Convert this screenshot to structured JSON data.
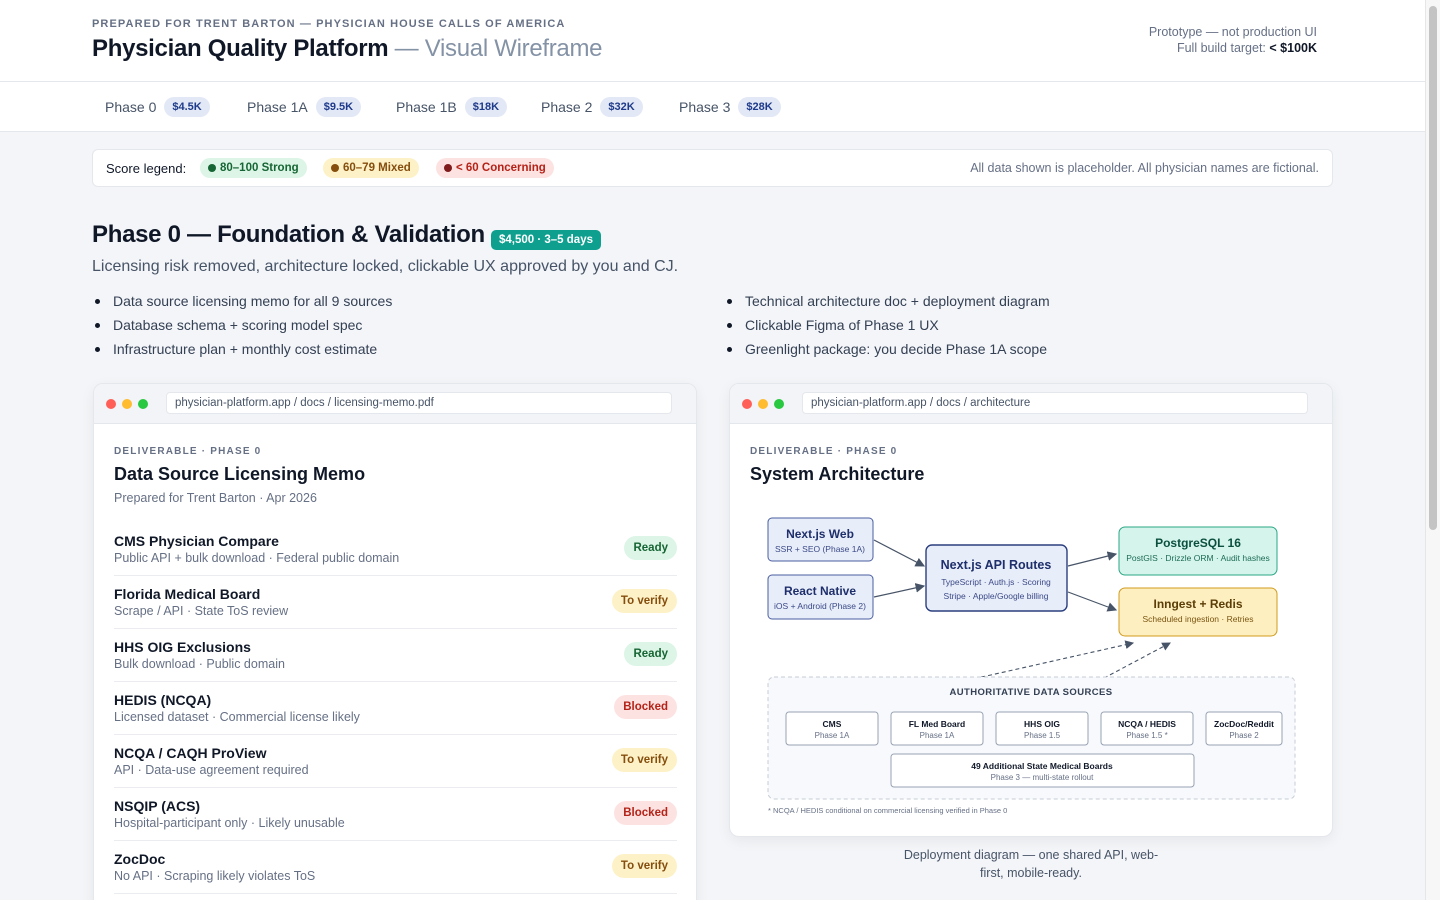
{
  "header": {
    "kicker": "PREPARED FOR TRENT BARTON — PHYSICIAN HOUSE CALLS OF AMERICA",
    "title": "Physician Quality Platform",
    "subtitle": "— Visual Wireframe",
    "proto_line1": "Prototype — not production UI",
    "proto_line2_prefix": "Full build target: ",
    "proto_line2_value": "< $100K"
  },
  "tabs": [
    {
      "label": "Phase 0",
      "price": "$4.5K"
    },
    {
      "label": "Phase 1A",
      "price": "$9.5K"
    },
    {
      "label": "Phase 1B",
      "price": "$18K"
    },
    {
      "label": "Phase 2",
      "price": "$32K"
    },
    {
      "label": "Phase 3",
      "price": "$28K"
    }
  ],
  "legend": {
    "label": "Score legend:",
    "strong": "80–100 Strong",
    "mixed": "60–79 Mixed",
    "concerning": "< 60 Concerning",
    "note": "All data shown is placeholder. All physician names are fictional."
  },
  "phase": {
    "title": "Phase 0 — Foundation & Validation",
    "badge": "$4,500 · 3–5 days",
    "desc": "Licensing risk removed, architecture locked, clickable UX approved by you and CJ.",
    "bullets_left": [
      "Data source licensing memo for all 9 sources",
      "Database schema + scoring model spec",
      "Infrastructure plan + monthly cost estimate"
    ],
    "bullets_right": [
      "Technical architecture doc + deployment diagram",
      "Clickable Figma of Phase 1 UX",
      "Greenlight package: you decide Phase 1A scope"
    ]
  },
  "memo": {
    "url": "physician-platform.app / docs / licensing-memo.pdf",
    "kicker": "DELIVERABLE · PHASE 0",
    "title": "Data Source Licensing Memo",
    "prepared": "Prepared for Trent Barton · Apr 2026",
    "sources": [
      {
        "name": "CMS Physician Compare",
        "desc": "Public API + bulk download · Federal public domain",
        "status": "Ready",
        "kind": "ready"
      },
      {
        "name": "Florida Medical Board",
        "desc": "Scrape / API · State ToS review",
        "status": "To verify",
        "kind": "verify"
      },
      {
        "name": "HHS OIG Exclusions",
        "desc": "Bulk download · Public domain",
        "status": "Ready",
        "kind": "ready"
      },
      {
        "name": "HEDIS (NCQA)",
        "desc": "Licensed dataset · Commercial license likely",
        "status": "Blocked",
        "kind": "blocked"
      },
      {
        "name": "NCQA / CAQH ProView",
        "desc": "API · Data-use agreement required",
        "status": "To verify",
        "kind": "verify"
      },
      {
        "name": "NSQIP (ACS)",
        "desc": "Hospital-participant only · Likely unusable",
        "status": "Blocked",
        "kind": "blocked"
      },
      {
        "name": "ZocDoc",
        "desc": "No API · Scraping likely violates ToS",
        "status": "To verify",
        "kind": "verify"
      }
    ]
  },
  "arch": {
    "url": "physician-platform.app / docs / architecture",
    "kicker": "DELIVERABLE · PHASE 0",
    "title": "System Architecture",
    "web_title": "Next.js Web",
    "web_sub": "SSR + SEO (Phase 1A)",
    "rn_title": "React Native",
    "rn_sub": "iOS + Android (Phase 2)",
    "api_title": "Next.js API Routes",
    "api_sub1": "TypeScript · Auth.js · Scoring",
    "api_sub2": "Stripe · Apple/Google billing",
    "pg_title": "PostgreSQL 16",
    "pg_sub": "PostGIS · Drizzle ORM · Audit hashes",
    "inn_title": "Inngest + Redis",
    "inn_sub": "Scheduled ingestion · Retries",
    "sources_label": "AUTHORITATIVE DATA SOURCES",
    "sources": [
      {
        "name": "CMS",
        "phase": "Phase 1A"
      },
      {
        "name": "FL Med Board",
        "phase": "Phase 1A"
      },
      {
        "name": "HHS OIG",
        "phase": "Phase 1.5"
      },
      {
        "name": "NCQA / HEDIS",
        "phase": "Phase 1.5 *"
      },
      {
        "name": "ZocDoc/Reddit",
        "phase": "Phase 2"
      }
    ],
    "states_title": "49 Additional State Medical Boards",
    "states_sub": "Phase 3 — multi-state rollout",
    "footnote": "* NCQA / HEDIS conditional on commercial licensing verified in Phase 0",
    "caption": "Deployment diagram — one shared API, web-first, mobile-ready."
  },
  "colors": {
    "accent_teal": "#0f9f8f",
    "ready_bg": "#dcf5e6",
    "verify_bg": "#fdf2c7",
    "blocked_bg": "#fde2e2",
    "client_box": "#e8edfa",
    "db_box": "#d5f5ec",
    "queue_box": "#fdefc0"
  }
}
